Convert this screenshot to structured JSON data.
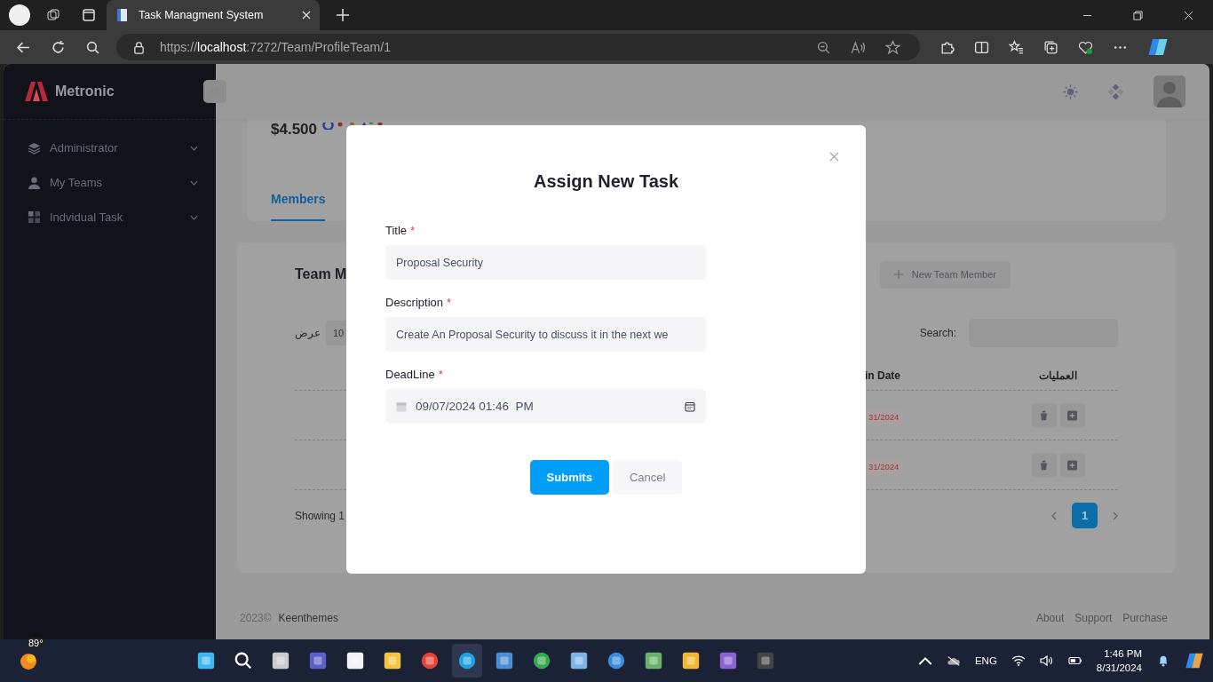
{
  "browser": {
    "tab_title": "Task Managment System",
    "url_scheme": "https://",
    "url_host": "localhost",
    "url_path": ":7272/Team/ProfileTeam/1"
  },
  "sidebar": {
    "brand": "Metronic",
    "items": [
      {
        "label": "Administrator"
      },
      {
        "label": "My Teams"
      },
      {
        "label": "Indvidual Task"
      }
    ]
  },
  "profile": {
    "stat": "$4.500",
    "tabs": [
      {
        "label": "Members",
        "selected": true
      }
    ]
  },
  "team_card": {
    "title": "Team M",
    "new_button": "New Team Member",
    "show_label": "عرض",
    "page_size": "10",
    "search_label": "Search:",
    "columns": [
      "in Date",
      "العمليات"
    ],
    "rows": [
      {
        "date": "31/2024"
      },
      {
        "date": "31/2024"
      }
    ],
    "showing": "Showing 1",
    "pages": [
      {
        "label": "1",
        "selected": true
      }
    ]
  },
  "modal": {
    "title": "Assign New Task",
    "fields": [
      {
        "kind": "text",
        "label": "Title",
        "required_mark": "*",
        "value": "Proposal Security"
      },
      {
        "kind": "text",
        "label": "Description",
        "required_mark": "*",
        "value": "Create An Proposal Security to discuss it in the next we"
      },
      {
        "kind": "datetime",
        "label": "DeadLine",
        "required_mark": "*",
        "value": "09/07/2024 01:46  PM"
      }
    ],
    "buttons": [
      {
        "kind": "primary",
        "label": "Submits"
      },
      {
        "kind": "secondary",
        "label": "Cancel"
      }
    ]
  },
  "footer": {
    "year": "2023©",
    "company": "Keenthemes",
    "links": [
      "About",
      "Support",
      "Purchase"
    ]
  },
  "taskbar": {
    "temperature": "89°",
    "language": "ENG",
    "time": "1:46 PM",
    "date": "8/31/2024"
  }
}
